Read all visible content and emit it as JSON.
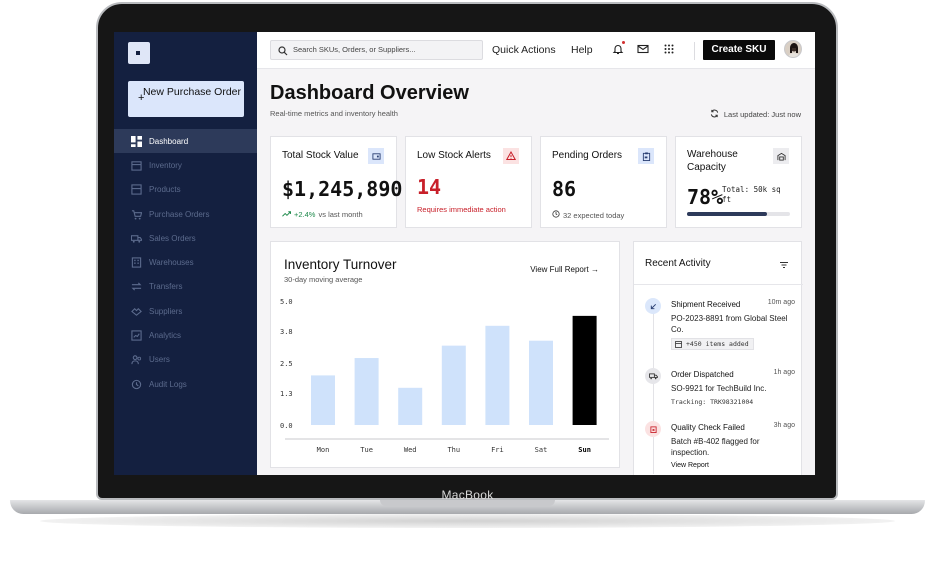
{
  "device": {
    "label": "MacBook"
  },
  "sidebar": {
    "new_po_label": "New Purchase Order",
    "items": [
      {
        "label": "Dashboard",
        "icon": "dashboard-icon",
        "active": true
      },
      {
        "label": "Inventory",
        "icon": "inventory-icon"
      },
      {
        "label": "Products",
        "icon": "products-icon"
      },
      {
        "label": "Purchase Orders",
        "icon": "cart-icon"
      },
      {
        "label": "Sales Orders",
        "icon": "truck-icon"
      },
      {
        "label": "Warehouses",
        "icon": "building-icon"
      },
      {
        "label": "Transfers",
        "icon": "transfer-icon"
      },
      {
        "label": "Suppliers",
        "icon": "handshake-icon"
      },
      {
        "label": "Analytics",
        "icon": "analytics-icon"
      },
      {
        "label": "Users",
        "icon": "users-icon"
      },
      {
        "label": "Audit Logs",
        "icon": "history-icon"
      }
    ]
  },
  "topbar": {
    "search_placeholder": "Search SKUs, Orders, or Suppliers...",
    "quick_actions": "Quick Actions",
    "help": "Help",
    "create_sku": "Create SKU"
  },
  "header": {
    "title": "Dashboard Overview",
    "subtitle": "Real-time metrics and inventory health",
    "last_updated": "Last updated: Just now"
  },
  "kpis": {
    "stock_value": {
      "title": "Total Stock Value",
      "value": "$1,245,890.",
      "delta": "+2.4%",
      "delta_note": "vs last month"
    },
    "low_stock": {
      "title": "Low Stock Alerts",
      "value": "14",
      "note": "Requires immediate action",
      "color": "#c8202a"
    },
    "pending": {
      "title": "Pending Orders",
      "value": "86",
      "note": "32 expected today"
    },
    "capacity": {
      "title": "Warehouse Capacity",
      "value": "78%",
      "note": "Total: 50k sq ft",
      "fill": 0.78
    }
  },
  "chart": {
    "title": "Inventory Turnover",
    "subtitle": "30-day moving average",
    "link": "View Full Report"
  },
  "chart_data": {
    "type": "bar",
    "categories": [
      "Mon",
      "Tue",
      "Wed",
      "Thu",
      "Fri",
      "Sat",
      "Sun"
    ],
    "values": [
      2.0,
      2.7,
      1.5,
      3.2,
      4.0,
      3.4,
      4.4
    ],
    "yticks": [
      "0.0",
      "1.3",
      "2.5",
      "3.8",
      "5.0"
    ],
    "ylim": [
      0,
      5.0
    ],
    "highlight": "Sun",
    "bar_color": "#cfe2fb",
    "highlight_color": "#000000"
  },
  "activity": {
    "title": "Recent Activity",
    "items": [
      {
        "name": "Shipment Received",
        "time": "10m ago",
        "desc": "PO-2023-8891 from Global Steel Co.",
        "chip": "+450 items added",
        "dot": "#dbe7fb"
      },
      {
        "name": "Order Dispatched",
        "time": "1h ago",
        "desc": "SO-9921 for TechBuild Inc.",
        "mono": "Tracking: TRK98321004",
        "dot": "#e6e6ea"
      },
      {
        "name": "Quality Check Failed",
        "time": "3h ago",
        "desc": "Batch #B-402 flagged for inspection.",
        "link": "View Report",
        "dot": "#fbe2e2"
      }
    ]
  }
}
